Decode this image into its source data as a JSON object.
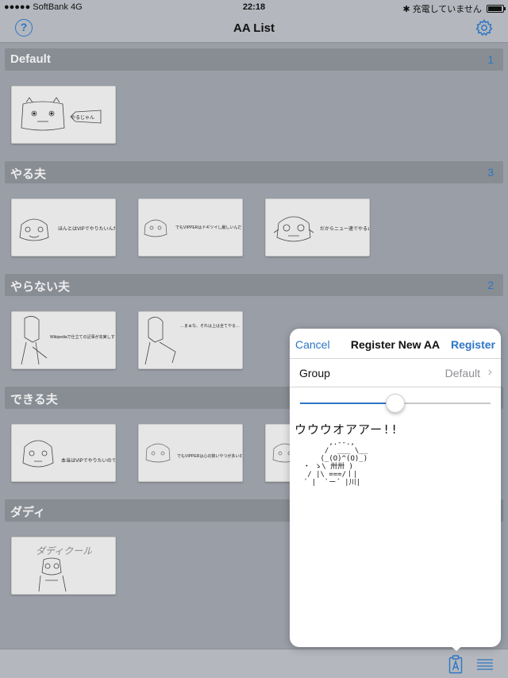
{
  "status_bar": {
    "carrier": "●●●●● SoftBank",
    "network": "4G",
    "time": "22:18",
    "bluetooth": "✱",
    "charging": "充電していません"
  },
  "nav": {
    "title": "AA List",
    "help_icon": "?"
  },
  "sections": [
    {
      "title": "Default",
      "count": "1",
      "items": [
        {
          "caption": "やるじゃん"
        }
      ]
    },
    {
      "title": "やる夫",
      "count": "3",
      "items": [
        {
          "caption": "ほんとはVIPでやりたいんだお…"
        },
        {
          "caption": "でもVIPPERはドギツイし厳しいんだなー心が折れる…"
        },
        {
          "caption": "だからニュー速でやるお!"
        }
      ]
    },
    {
      "title": "やらない夫",
      "count": "2",
      "items": [
        {
          "caption": "Wikipediaで仕立ての記事が充実しすぎだろ…"
        },
        {
          "caption": "…まぁな、それは上は全てやる…"
        }
      ]
    },
    {
      "title": "できる夫",
      "count": "",
      "items": [
        {
          "caption": "本当はVIPでやりたいのです"
        },
        {
          "caption": "でもVIPPERは心の狭いやつが多いので…"
        },
        {
          "caption": ""
        }
      ]
    },
    {
      "title": "ダディ",
      "count": "",
      "items": [
        {
          "caption": "ダディクール"
        }
      ]
    }
  ],
  "popover": {
    "cancel": "Cancel",
    "title": "Register New AA",
    "register": "Register",
    "group_label": "Group",
    "group_value": "Default",
    "chevron": "›",
    "slider_value": 0.5,
    "aa_first_line": "ウウウオアアー!!",
    "aa_art": "        ,.--.,\n       /  ___ \\__\n      (_(O)^(O)_)\n  ・ ゝ\\ 卅卅 )\n   / |\\ ===/丨|\n  ´ |  `ー´ |川|"
  },
  "colors": {
    "accent": "#2c76c6",
    "background": "#9a9ea6",
    "bar": "#b4b7bd",
    "section_header": "#888c93"
  },
  "icons": {
    "settings": "gear-icon",
    "help": "question-circle-icon",
    "new_aa": "clipboard-a-icon",
    "menu": "list-icon"
  }
}
